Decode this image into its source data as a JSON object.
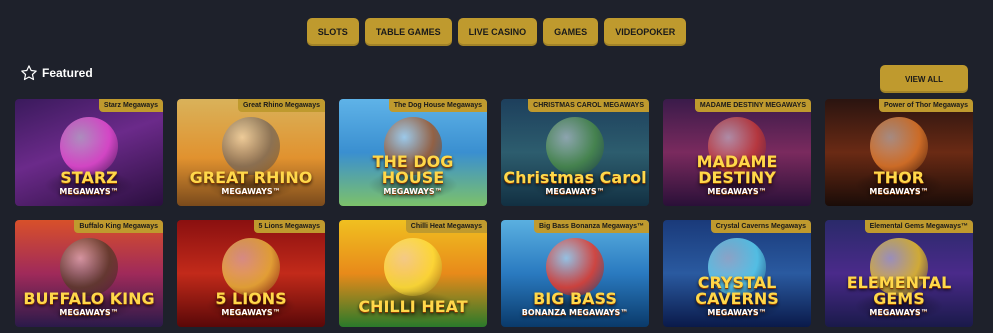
{
  "tabs": [
    "SLOTS",
    "TABLE GAMES",
    "LIVE CASINO",
    "GAMES",
    "VIDEOPOKER"
  ],
  "section": {
    "title": "Featured",
    "view_all": "VIEW ALL"
  },
  "games": [
    {
      "label": "Starz Megaways",
      "art_title": "STARZ",
      "art_sub": "MEGAWAYS™",
      "bg": "linear-gradient(160deg,#3a1a5c,#6b2a8a 45%,#2a0f3e)",
      "accent": "#e64bd0"
    },
    {
      "label": "Great Rhino Megaways",
      "art_title": "GREAT RHINO",
      "art_sub": "MEGAWAYS™",
      "bg": "linear-gradient(180deg,#d9b25a,#e1922f 55%,#7a4a1c)",
      "accent": "#7d6a57"
    },
    {
      "label": "The Dog House Megaways",
      "art_title": "THE DOG HOUSE",
      "art_sub": "MEGAWAYS™",
      "bg": "linear-gradient(180deg,#5fb3e8,#3a8fd0 50%,#7cc16a)",
      "accent": "#a0572b"
    },
    {
      "label": "CHRISTMAS CAROL MEGAWAYS",
      "art_title": "Christmas Carol",
      "art_sub": "MEGAWAYS™",
      "bg": "linear-gradient(180deg,#1d3f5c,#2d5d6e 50%,#123042)",
      "accent": "#4a8a4a"
    },
    {
      "label": "MADAME DESTINY MEGAWAYS",
      "art_title": "MADAME DESTINY",
      "art_sub": "MEGAWAYS™",
      "bg": "linear-gradient(180deg,#3a1b4a,#7a2a5e 50%,#2a1038)",
      "accent": "#c23a3a"
    },
    {
      "label": "Power of Thor Megaways",
      "art_title": "THOR",
      "art_sub": "MEGAWAYS™",
      "bg": "linear-gradient(180deg,#2a1410,#6a2a14 50%,#1a0c08)",
      "accent": "#e0782a"
    },
    {
      "label": "Buffalo King Megaways",
      "art_title": "BUFFALO KING",
      "art_sub": "MEGAWAYS™",
      "bg": "linear-gradient(180deg,#d8502a,#a02a5a 50%,#2a1a4a)",
      "accent": "#5a3a2a"
    },
    {
      "label": "5 Lions Megaways",
      "art_title": "5 LIONS",
      "art_sub": "MEGAWAYS™",
      "bg": "linear-gradient(180deg,#8a1010,#c22a1a 50%,#5a0808)",
      "accent": "#e8b23a"
    },
    {
      "label": "Chilli Heat Megaways",
      "art_title": "CHILLI HEAT",
      "art_sub": "",
      "bg": "linear-gradient(180deg,#f0c020,#e88a1a 50%,#2a7a2a)",
      "accent": "#ffdf3a"
    },
    {
      "label": "Big Bass Bonanza Megaways™",
      "art_title": "BIG BASS",
      "art_sub": "BONANZA MEGAWAYS™",
      "bg": "linear-gradient(180deg,#5ab0e0,#2a7ac0 50%,#0a3a6a)",
      "accent": "#e83a2a"
    },
    {
      "label": "Crystal Caverns Megaways",
      "art_title": "CRYSTAL CAVERNS",
      "art_sub": "MEGAWAYS™",
      "bg": "linear-gradient(180deg,#1a3a7a,#2a5aa0 50%,#0a1a4a)",
      "accent": "#5ad0f0"
    },
    {
      "label": "Elemental Gems Megaways™",
      "art_title": "ELEMENTAL GEMS",
      "art_sub": "MEGAWAYS™",
      "bg": "linear-gradient(180deg,#2a2a6a,#4a2a8a 50%,#1a1a4a)",
      "accent": "#e8c02a"
    }
  ]
}
